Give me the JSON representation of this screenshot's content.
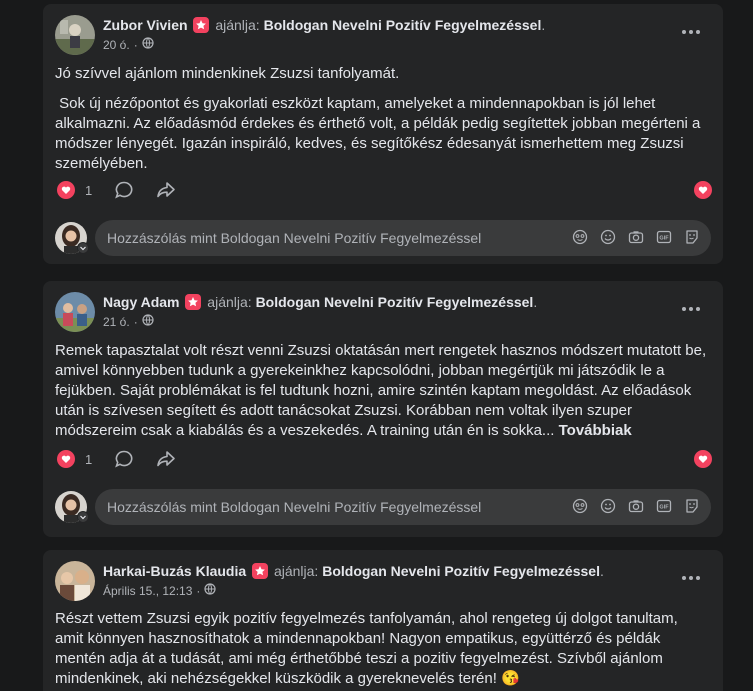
{
  "posts": [
    {
      "author": "Zubor Vivien",
      "verb": "ajánlja:",
      "page": "Boldogan Nevelni Pozitív Fegyelmezéssel",
      "dot": ".",
      "time": "20 ó.",
      "paragraphs": [
        "Jó szívvel ajánlom mindenkinek Zsuzsi tanfolyamát.",
        " Sok új nézőpontot és gyakorlati eszközt kaptam, amelyeket a mindennapokban is jól lehet alkalmazni. Az előadásmód érdekes és érthető volt, a példák pedig segítettek jobban megérteni a módszer lényegét. Igazán inspiráló, kedves, és segítőkész édesanyát ismerhettem meg Zsuzsi személyében."
      ],
      "like_count": "1",
      "comment_placeholder": "Hozzászólás mint Boldogan Nevelni Pozitív Fegyelmezéssel"
    },
    {
      "author": "Nagy Adam",
      "verb": "ajánlja:",
      "page": "Boldogan Nevelni Pozitív Fegyelmezéssel",
      "dot": ".",
      "time": "21 ó.",
      "text": "Remek tapasztalat volt részt venni Zsuzsi oktatásán mert rengetek hasznos módszert mutatott be, amivel könnyebben tudunk a gyerekeinkhez kapcsolódni, jobban megértjük mi játszódik le a fejükben. Saját problémákat is fel tudtunk hozni, amire szintén kaptam megoldást. Az előadások után is szívesen segített és adott tanácsokat Zsuzsi. Korábban nem voltak ilyen szuper módszereim csak a kiabálás és a veszekedés. A training után én is sokka...",
      "see_more": "Továbbiak",
      "like_count": "1",
      "comment_placeholder": "Hozzászólás mint Boldogan Nevelni Pozitív Fegyelmezéssel"
    },
    {
      "author": "Harkai-Buzás Klaudia",
      "verb": "ajánlja:",
      "page": "Boldogan Nevelni Pozitív Fegyelmezéssel",
      "dot": ".",
      "time": "Április 15., 12:13",
      "text": "Részt vettem Zsuzsi egyik pozitív fegyelmezés tanfolyamán, ahol rengeteg új dolgot tanultam, amit könnyen hasznosíthatok a mindennapokban! Nagyon empatikus, együttérző és példák mentén adja át a tudását, ami még érthetőbbé teszi a pozitiv fegyelmezést. Szívből ajánlom mindenkinek, aki nehézségekkel küszködik a gyereknevelés terén!",
      "emoji": "😘"
    }
  ],
  "icons": [
    "recommend-badge-icon",
    "globe-icon",
    "more-icon",
    "like-heart-icon",
    "comment-icon",
    "share-icon",
    "avatar-sticker-icon",
    "emoji-icon",
    "camera-icon",
    "gif-icon",
    "sticker-icon",
    "chevron-down-icon"
  ],
  "colors": {
    "background": "#18191a",
    "card": "#242526",
    "input": "#3a3b3c",
    "accent": "#f3425f",
    "text": "#e4e6eb",
    "muted": "#b0b3b8"
  }
}
